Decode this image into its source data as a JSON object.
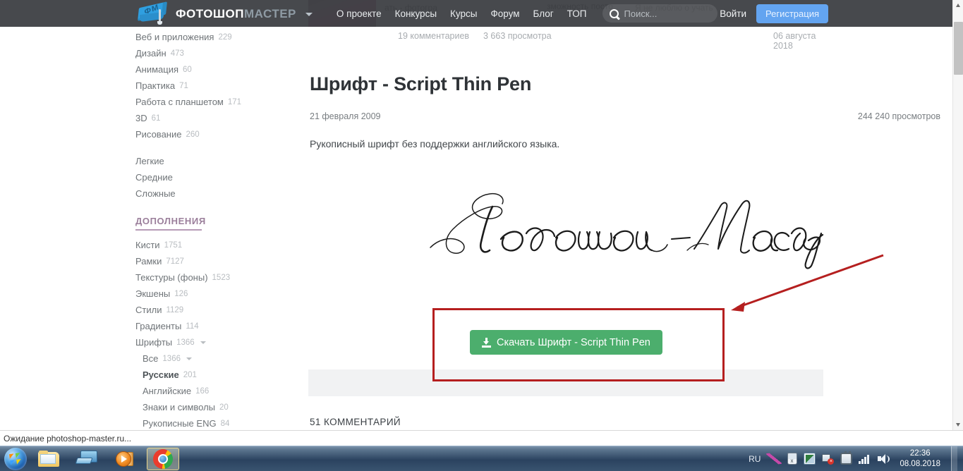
{
  "header": {
    "logo_primary": "ФОТОШОП",
    "logo_secondary": "МАСТЕР",
    "logo_badge": "ФМ",
    "nav": [
      {
        "label": "О проекте"
      },
      {
        "label": "Конкурсы"
      },
      {
        "label": "Курсы"
      },
      {
        "label": "Форум"
      },
      {
        "label": "Блог"
      },
      {
        "label": "ТОП"
      }
    ],
    "search_placeholder": "Поиск...",
    "login_label": "Войти",
    "register_label": "Регистрация"
  },
  "ghost": {
    "line1": "Я не люблю о учать",
    "line2": "зможность посто",
    "line3": "ать  - фотогра"
  },
  "sidebar": {
    "categories": [
      {
        "label": "Веб и приложения",
        "count": "229"
      },
      {
        "label": "Дизайн",
        "count": "473"
      },
      {
        "label": "Анимация",
        "count": "60"
      },
      {
        "label": "Практика",
        "count": "71"
      },
      {
        "label": "Работа с планшетом",
        "count": "171"
      },
      {
        "label": "3D",
        "count": "61"
      },
      {
        "label": "Рисование",
        "count": "260"
      }
    ],
    "levels": [
      {
        "label": "Легкие",
        "count": ""
      },
      {
        "label": "Средние",
        "count": ""
      },
      {
        "label": "Сложные",
        "count": ""
      }
    ],
    "addons_heading": "ДОПОЛНЕНИЯ",
    "addons": [
      {
        "label": "Кисти",
        "count": "1751",
        "caret": false,
        "indent": false,
        "active": false
      },
      {
        "label": "Рамки",
        "count": "7127",
        "caret": false,
        "indent": false,
        "active": false
      },
      {
        "label": "Текстуры (фоны)",
        "count": "1523",
        "caret": false,
        "indent": false,
        "active": false
      },
      {
        "label": "Экшены",
        "count": "126",
        "caret": false,
        "indent": false,
        "active": false
      },
      {
        "label": "Стили",
        "count": "1129",
        "caret": false,
        "indent": false,
        "active": false
      },
      {
        "label": "Градиенты",
        "count": "114",
        "caret": false,
        "indent": false,
        "active": false
      },
      {
        "label": "Шрифты",
        "count": "1366",
        "caret": true,
        "indent": false,
        "active": false
      },
      {
        "label": "Все",
        "count": "1366",
        "caret": true,
        "indent": true,
        "active": false
      },
      {
        "label": "Русские",
        "count": "201",
        "caret": false,
        "indent": true,
        "active": true
      },
      {
        "label": "Английские",
        "count": "166",
        "caret": false,
        "indent": true,
        "active": false
      },
      {
        "label": "Знаки и символы",
        "count": "20",
        "caret": false,
        "indent": true,
        "active": false
      },
      {
        "label": "Рукописные ENG",
        "count": "84",
        "caret": false,
        "indent": true,
        "active": false
      }
    ]
  },
  "article": {
    "prev_comments": "19 комментариев",
    "prev_views": "3 663 просмотра",
    "prev_date": "06 августа 2018",
    "title": "Шрифт - Script Thin Pen",
    "date": "21 февраля 2009",
    "views": "244 240 просмотров",
    "description": "Рукописный шрифт без поддержки английского языка.",
    "sample_text": "Фотошоп-Мастер",
    "download_label": "Скачать Шрифт - Script Thin Pen",
    "comments_heading": "51 КОММЕНТАРИЙ"
  },
  "annotation": {
    "box_color": "#b51f1f",
    "arrow_color": "#b51f1f"
  },
  "browser": {
    "status_text": "Ожидание photoshop-master.ru..."
  },
  "taskbar": {
    "items": [
      {
        "name": "start-orb",
        "label": ""
      },
      {
        "name": "explorer",
        "label": ""
      },
      {
        "name": "remote-desktop",
        "label": ""
      },
      {
        "name": "media-player",
        "label": ""
      },
      {
        "name": "chrome",
        "label": ""
      }
    ],
    "language": "RU",
    "clock_time": "22:36",
    "clock_date": "08.08.2018"
  },
  "colors": {
    "header_bg": "#3c3e42",
    "register_btn": "#63a4f0",
    "download_btn": "#4cae6d",
    "addons_heading": "#9b7f9b",
    "comments_underline": "#6fa8d6"
  }
}
